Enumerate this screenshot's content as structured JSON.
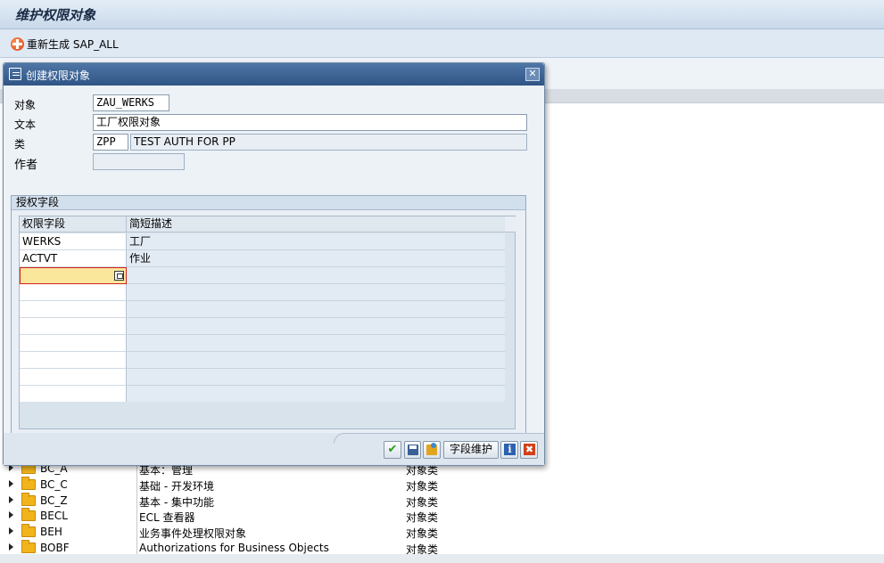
{
  "window": {
    "title": "维护权限对象"
  },
  "toolbar": {
    "regen_label": "重新生成 SAP_ALL"
  },
  "tree": {
    "rows": [
      {
        "name": "BC_A",
        "desc": "基本：管理",
        "type": "对象类"
      },
      {
        "name": "BC_C",
        "desc": "基础 - 开发环境",
        "type": "对象类"
      },
      {
        "name": "BC_Z",
        "desc": "基本 - 集中功能",
        "type": "对象类"
      },
      {
        "name": "BECL",
        "desc": "ECL 查看器",
        "type": "对象类"
      },
      {
        "name": "BEH",
        "desc": "业务事件处理权限对象",
        "type": "对象类"
      },
      {
        "name": "BOBF",
        "desc": "Authorizations for Business Objects",
        "type": "对象类"
      }
    ]
  },
  "dialog": {
    "title": "创建权限对象",
    "close_label": "✕",
    "fields": {
      "object_label": "对象",
      "object_value": "ZAU_WERKS",
      "text_label": "文本",
      "text_value": "工厂权限对象",
      "class_label": "类",
      "class_value": "ZPP",
      "class_desc": "TEST AUTH FOR PP",
      "author_label": "作者",
      "author_value": ""
    },
    "group": {
      "title": "授权字段",
      "columns": [
        "权限字段",
        "简短描述"
      ],
      "rows": [
        {
          "field": "WERKS",
          "desc": "工厂"
        },
        {
          "field": "ACTVT",
          "desc": "作业"
        },
        {
          "field": "",
          "desc": ""
        },
        {
          "field": "",
          "desc": ""
        },
        {
          "field": "",
          "desc": ""
        },
        {
          "field": "",
          "desc": ""
        },
        {
          "field": "",
          "desc": ""
        },
        {
          "field": "",
          "desc": ""
        },
        {
          "field": "",
          "desc": ""
        },
        {
          "field": "",
          "desc": ""
        }
      ]
    },
    "buttons": {
      "field_maint_label": "字段维护",
      "info_label": "i",
      "cancel_label": "✖"
    }
  }
}
